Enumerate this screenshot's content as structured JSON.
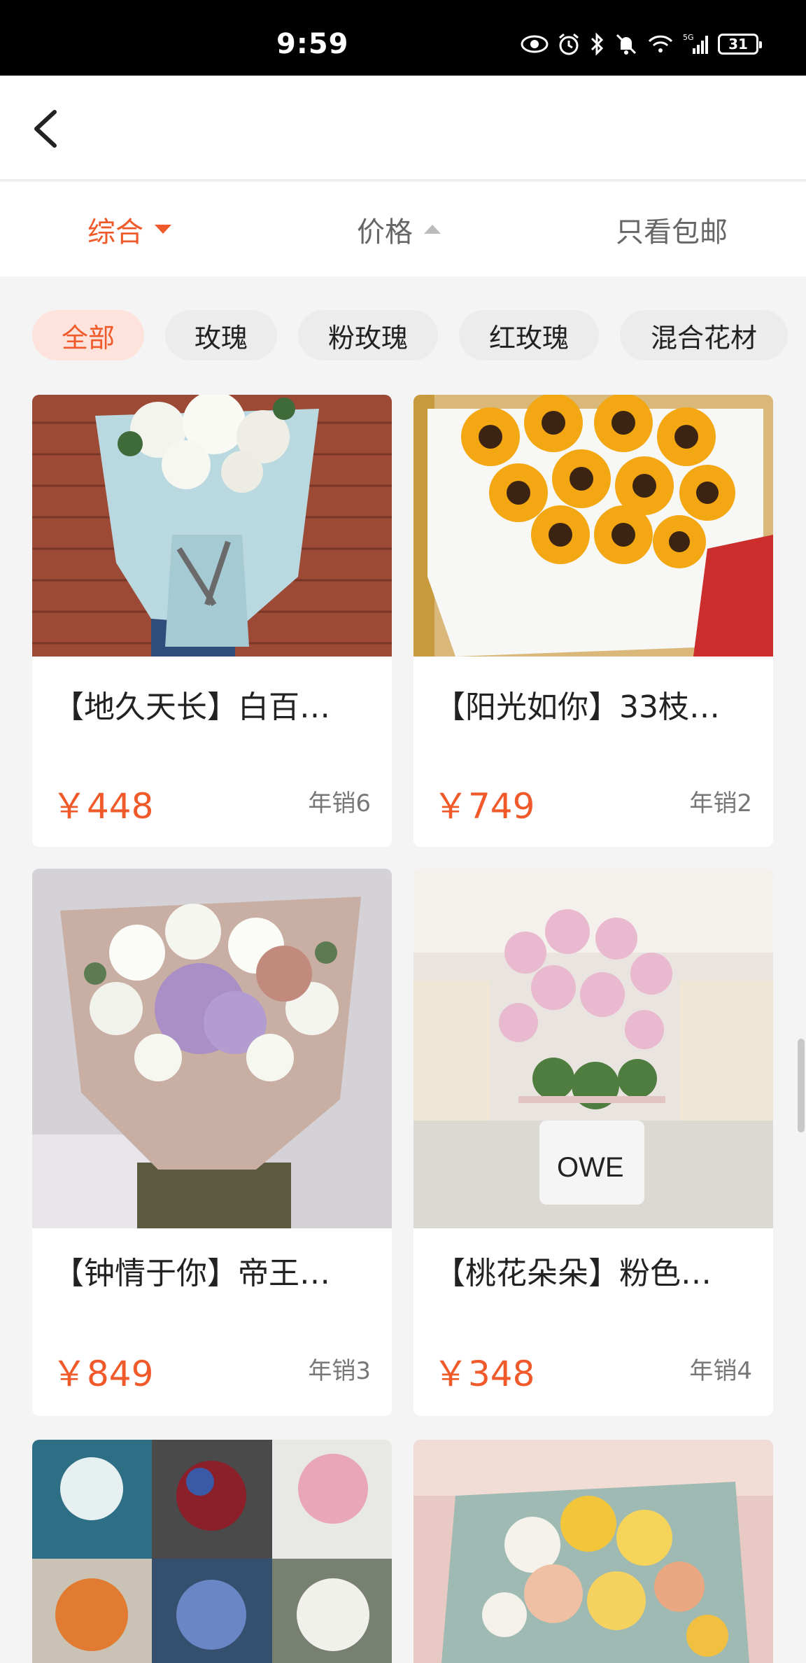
{
  "status_bar": {
    "time": "9:59",
    "battery": "31",
    "network": "5G"
  },
  "nav": {
    "back_icon": "chevron-left-icon"
  },
  "sort": {
    "items": [
      {
        "label": "综合",
        "active": true,
        "arrow": "down"
      },
      {
        "label": "价格",
        "active": false,
        "arrow": "up"
      },
      {
        "label": "只看包邮",
        "active": false
      }
    ]
  },
  "categories": [
    "全部",
    "玫瑰",
    "粉玫瑰",
    "红玫瑰",
    "混合花材"
  ],
  "products": [
    {
      "title": "【地久天长】白百…",
      "price": "￥448",
      "sales": "年销6"
    },
    {
      "title": "【阳光如你】33枝…",
      "price": "￥749",
      "sales": "年销2"
    },
    {
      "title": "【钟情于你】帝王…",
      "price": "￥849",
      "sales": "年销3"
    },
    {
      "title": "【桃花朵朵】粉色…",
      "price": "￥348",
      "sales": "年销4"
    }
  ],
  "colors": {
    "accent": "#f05a2a",
    "chip_active_bg": "#fde3dc",
    "background": "#f4f4f4"
  }
}
